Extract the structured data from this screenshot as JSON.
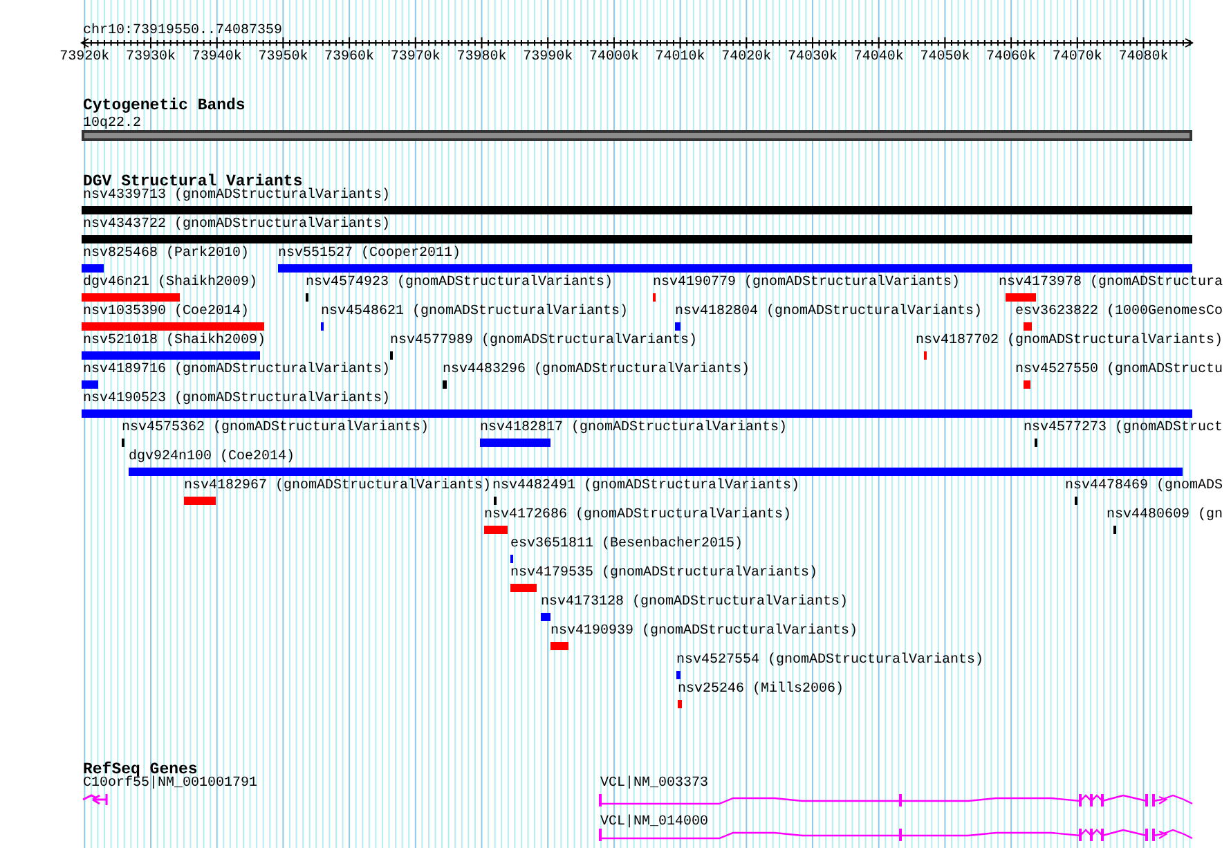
{
  "ruler": {
    "region": "chr10:73919550..74087359",
    "ticks": [
      "73920k",
      "73930k",
      "73940k",
      "73950k",
      "73960k",
      "73970k",
      "73980k",
      "73990k",
      "74000k",
      "74010k",
      "74020k",
      "74030k",
      "74040k",
      "74050k",
      "74060k",
      "74070k",
      "74080k"
    ]
  },
  "tracks": [
    {
      "kind": "cytoband",
      "title": "Cytogenetic Bands",
      "features": [
        {
          "label": "10q22.2"
        }
      ]
    },
    {
      "kind": "variants",
      "title": "DGV Structural Variants",
      "lanes": [
        {
          "features": [
            {
              "label": "nsv4339713 (gnomADStructuralVariants)",
              "color": "#000000"
            }
          ]
        },
        {
          "features": [
            {
              "label": "nsv4343722 (gnomADStructuralVariants)",
              "color": "#000000"
            }
          ]
        },
        {
          "features": [
            {
              "label": "nsv825468 (Park2010)",
              "color": "#0000ff"
            },
            {
              "label": "nsv551527 (Cooper2011)",
              "color": "#0000ff"
            }
          ]
        },
        {
          "features": [
            {
              "label": "dgv46n21 (Shaikh2009)",
              "color": "#ff0000"
            },
            {
              "label": "nsv4574923 (gnomADStructuralVariants)",
              "color": "#000000"
            },
            {
              "label": "nsv4190779 (gnomADStructuralVariants)",
              "color": "#ff0000"
            },
            {
              "label": "nsv4173978 (gnomADStructura",
              "color": "#ff0000"
            }
          ]
        },
        {
          "features": [
            {
              "label": "nsv1035390 (Coe2014)",
              "color": "#ff0000"
            },
            {
              "label": "nsv4548621 (gnomADStructuralVariants)",
              "color": "#0000ff"
            },
            {
              "label": "nsv4182804 (gnomADStructuralVariants)",
              "color": "#0000ff"
            },
            {
              "label": "esv3623822 (1000GenomesCo",
              "color": "#ff0000"
            }
          ]
        },
        {
          "features": [
            {
              "label": "nsv521018 (Shaikh2009)",
              "color": "#0000ff"
            },
            {
              "label": "nsv4577989 (gnomADStructuralVariants)",
              "color": "#000000"
            },
            {
              "label": "nsv4187702 (gnomADStructuralVariants)",
              "color": "#ff0000"
            }
          ]
        },
        {
          "features": [
            {
              "label": "nsv4189716 (gnomADStructuralVariants)",
              "color": "#0000ff"
            },
            {
              "label": "nsv4483296 (gnomADStructuralVariants)",
              "color": "#000000"
            },
            {
              "label": "nsv4527550 (gnomADStructu",
              "color": "#ff0000"
            }
          ]
        },
        {
          "features": [
            {
              "label": "nsv4190523 (gnomADStructuralVariants)",
              "color": "#0000ff"
            }
          ]
        },
        {
          "features": [
            {
              "label": "nsv4575362 (gnomADStructuralVariants)",
              "color": "#000000"
            },
            {
              "label": "nsv4182817 (gnomADStructuralVariants)",
              "color": "#0000ff"
            },
            {
              "label": "nsv4577273 (gnomADStruct",
              "color": "#000000"
            }
          ]
        },
        {
          "features": [
            {
              "label": "dgv924n100 (Coe2014)",
              "color": "#0000ff"
            }
          ]
        },
        {
          "features": [
            {
              "label": "nsv4182967 (gnomADStructuralVariants)",
              "color": "#ff0000"
            },
            {
              "label": "nsv4482491 (gnomADStructuralVariants)",
              "color": "#000000"
            },
            {
              "label": "nsv4478469 (gnomADS",
              "color": "#000000"
            }
          ]
        },
        {
          "features": [
            {
              "label": "nsv4172686 (gnomADStructuralVariants)",
              "color": "#ff0000"
            },
            {
              "label": "nsv4480609 (gn",
              "color": "#000000"
            }
          ]
        },
        {
          "features": [
            {
              "label": "esv3651811 (Besenbacher2015)",
              "color": "#0000ff"
            }
          ]
        },
        {
          "features": [
            {
              "label": "nsv4179535 (gnomADStructuralVariants)",
              "color": "#ff0000"
            }
          ]
        },
        {
          "features": [
            {
              "label": "nsv4173128 (gnomADStructuralVariants)",
              "color": "#0000ff"
            }
          ]
        },
        {
          "features": [
            {
              "label": "nsv4190939 (gnomADStructuralVariants)",
              "color": "#ff0000"
            }
          ]
        },
        {
          "features": [
            {
              "label": "nsv4527554 (gnomADStructuralVariants)",
              "color": "#0000ff"
            }
          ]
        },
        {
          "features": [
            {
              "label": "nsv25246 (Mills2006)",
              "color": "#ff0000"
            }
          ]
        }
      ]
    },
    {
      "kind": "genes",
      "title": "RefSeq Genes",
      "features": [
        {
          "label": "C10orf55|NM_001001791"
        },
        {
          "label": "VCL|NM_003373"
        },
        {
          "label": "VCL|NM_014000"
        }
      ]
    }
  ]
}
